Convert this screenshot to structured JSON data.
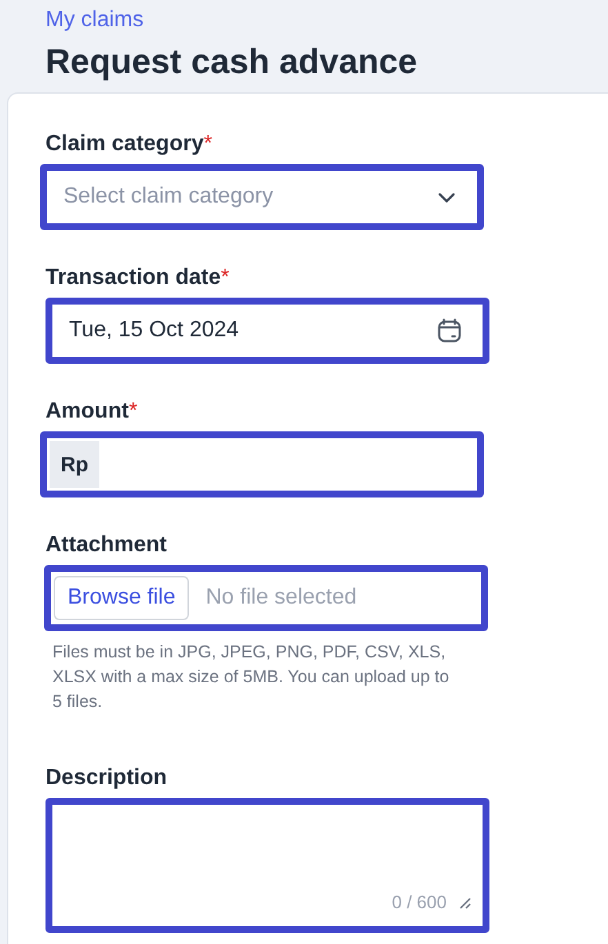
{
  "breadcrumb": "My claims",
  "title": "Request cash advance",
  "fields": [
    {
      "kind": "select",
      "label": "Claim category",
      "required_mark": "*",
      "placeholder": "Select claim category"
    },
    {
      "kind": "date",
      "label": "Transaction date",
      "required_mark": "*",
      "value": "Tue, 15 Oct 2024"
    },
    {
      "kind": "currency",
      "label": "Amount",
      "required_mark": "*",
      "prefix": "Rp"
    },
    {
      "kind": "file",
      "label": "Attachment",
      "button": "Browse file",
      "status": "No file selected",
      "help": "Files must be in JPG, JPEG, PNG, PDF, CSV, XLS, XLSX with a max size of 5MB. You can upload up to 5 files."
    },
    {
      "kind": "textarea",
      "label": "Description",
      "counter": "0 / 600"
    }
  ]
}
